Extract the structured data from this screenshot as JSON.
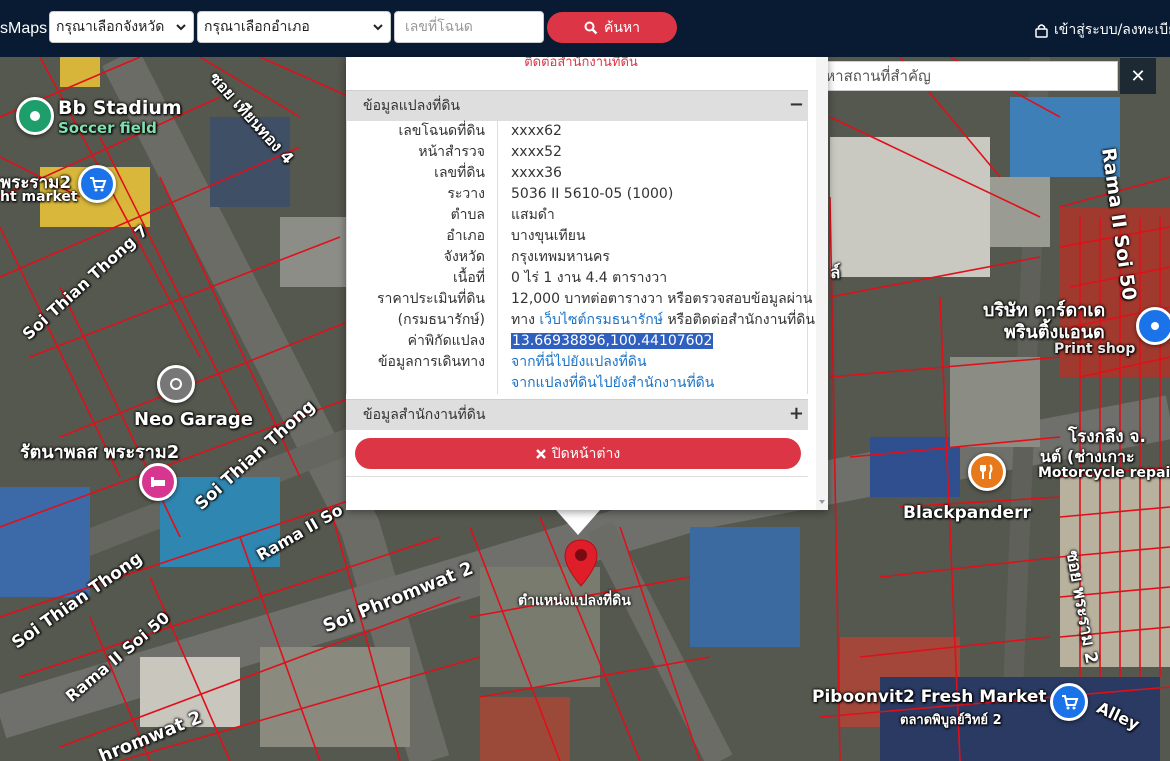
{
  "navbar": {
    "brand": "sMaps",
    "province_select": "กรุณาเลือกจังหวัด",
    "district_select": "กรุณาเลือกอำเภอ",
    "deed_placeholder": "เลขที่โฉนด",
    "search_label": "ค้นหา",
    "login_label": "เข้าสู่ระบบ/ลงทะเบีย"
  },
  "place_search": {
    "placeholder": "ค้นหาสถานที่สำคัญ",
    "close_label": "✕"
  },
  "popup": {
    "top_contact": "ติดต่อสำนักงานที่ดิน",
    "section_land": "ข้อมูลแปลงที่ดิน",
    "section_land_toggle": "−",
    "rows": [
      {
        "k": "เลขโฉนดที่ดิน",
        "v": "xxxx62"
      },
      {
        "k": "หน้าสำรวจ",
        "v": "xxxx52"
      },
      {
        "k": "เลขที่ดิน",
        "v": "xxxx36"
      },
      {
        "k": "ระวาง",
        "v": "5036 II 5610-05 (1000)"
      },
      {
        "k": "ตำบล",
        "v": "แสมดำ"
      },
      {
        "k": "อำเภอ",
        "v": "บางขุนเทียน"
      },
      {
        "k": "จังหวัด",
        "v": "กรุงเทพมหานคร"
      },
      {
        "k": "เนื้อที่",
        "v": "0 ไร่ 1 งาน 4.4 ตารางวา"
      },
      {
        "k": "ราคาประเมินที่ดิน",
        "v": "12,000 บาทต่อตารางวา หรือตรวจสอบข้อมูลผ่าน"
      }
    ],
    "dept_key": "(กรมธนารักษ์)",
    "dept_prefix": "ทาง",
    "dept_link": "เว็บไซต์กรมธนารักษ์",
    "dept_suffix": "หรือติดต่อสำนักงานที่ดิน",
    "coord_key": "ค่าพิกัดแปลง",
    "coord_value": "13.66938896,100.44107602",
    "travel_key": "ข้อมูลการเดินทาง",
    "travel_link_1": "จากที่นี่ไปยังแปลงที่ดิน",
    "travel_link_2": "จากแปลงที่ดินไปยังสำนักงานที่ดิน",
    "section_office": "ข้อมูลสำนักงานที่ดิน",
    "section_office_toggle": "+",
    "close_label": "ปิดหน้าต่าง"
  },
  "marker_label": "ตำแหน่งแปลงที่ดิน",
  "map_labels": {
    "bb_stadium": "Bb Stadium",
    "soccer_field": "Soccer field",
    "rama2_market_1": "พระราม2",
    "rama2_market_2": "ht market",
    "soi_thian_thong_4": "ซอย เทียนทอง 4",
    "soi_thian_thong_7": "Soi Thian Thong 7",
    "neo_garage": "Neo Garage",
    "rattanaphon": "รัตนาพลส พระราม2",
    "soi_thian_thong_a": "Soi Thian Thong",
    "soi_thian_thong_b": "Soi Thian Thong",
    "rama2_soi50_a": "Rama II Soi 50",
    "rama2_soi50_b": "Rama II Soi 50",
    "rama2_soi_c": "Rama II So",
    "soi_phromwat_2": "Soi Phromwat 2",
    "phromwat_2_b": "hromwat 2",
    "rama2_soi50_right": "Rama II Soi 50",
    "company_1": "บริษัท ดาร์ดาเด",
    "company_2": "พรินติ้งแอนด",
    "print_shop": "Print shop",
    "garage_1": "โรงกลึง จ.",
    "garage_2": "นต์ (ช่างเกาะ",
    "motorcycle": "Motorcycle repair",
    "blackpanderr": "Blackpanderr",
    "soi_rama2_right": "ซอย พระราม 2",
    "alley": "Alley",
    "piboonvit": "Piboonvit2 Fresh Market",
    "piboonvit_th": "ตลาดพิบูลย์วิทย์ 2",
    "sol_partial": "ล์"
  },
  "colors": {
    "navbar": "#081b33",
    "accent_red": "#dc3545",
    "parcel_line": "#e0101a",
    "link": "#1a73c8",
    "highlight": "#2f5fbf"
  }
}
